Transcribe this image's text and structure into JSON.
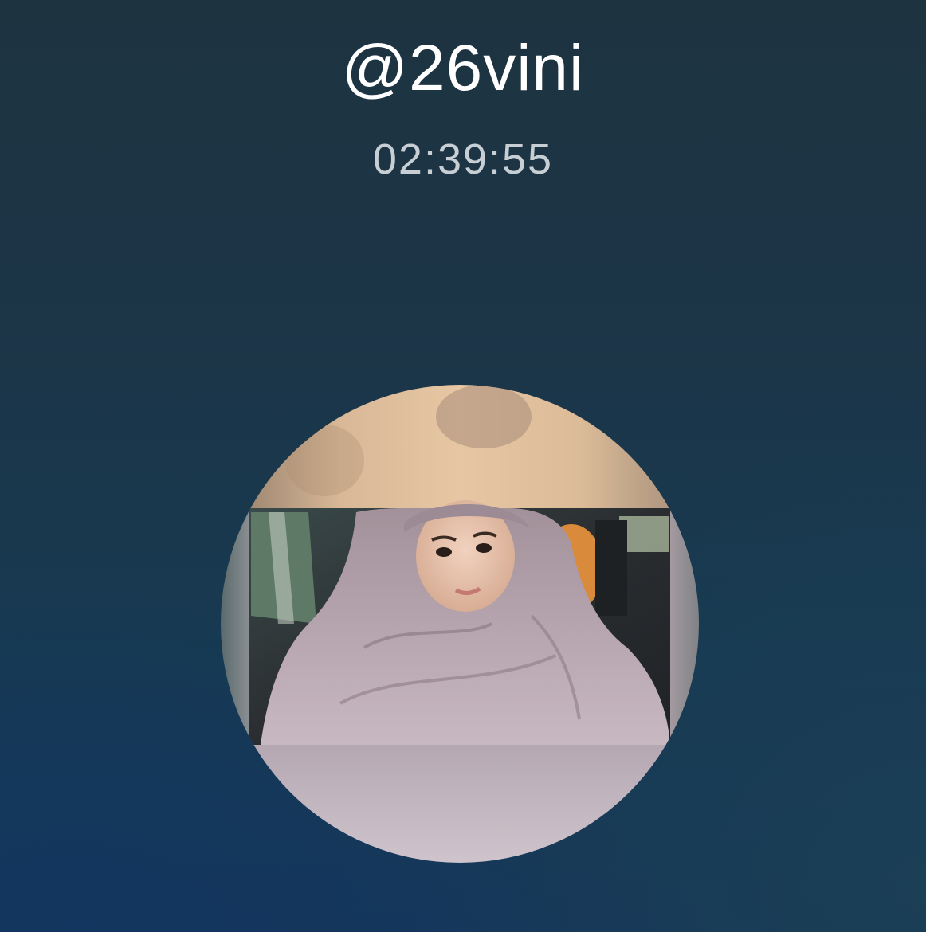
{
  "call": {
    "caller_name": "@26vini",
    "duration": "02:39:55"
  },
  "avatar": {
    "icon": "contact-photo"
  }
}
